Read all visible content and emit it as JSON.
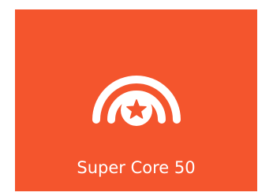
{
  "tile": {
    "label": "Super Core 50",
    "icon": "broadcast-star-icon",
    "background_color": "#f4552d",
    "foreground_color": "#ffffff"
  }
}
